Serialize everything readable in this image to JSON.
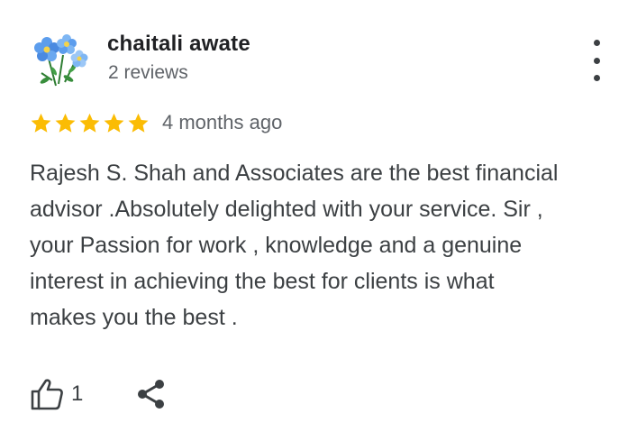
{
  "review": {
    "author_name": "chaitali awate",
    "review_count": "2 reviews",
    "rating": 5,
    "rating_max": 5,
    "date": "4 months ago",
    "text": "Rajesh S. Shah and Associates are the best financial\nadvisor .Absolutely delighted with your service. Sir ,\nyour Passion for work , knowledge and a genuine\ninterest in achieving the best for clients is what\nmakes you the best .",
    "like_count": "1"
  },
  "icons": {
    "avatar": "flower-avatar-icon",
    "more": "more-vert-icon",
    "star": "star-icon",
    "like": "thumb-up-outline-icon",
    "share": "share-icon"
  },
  "colors": {
    "star": "#fbbc04",
    "name": "#202124",
    "secondary_text": "#5f6368",
    "body_text": "#3c4043"
  }
}
